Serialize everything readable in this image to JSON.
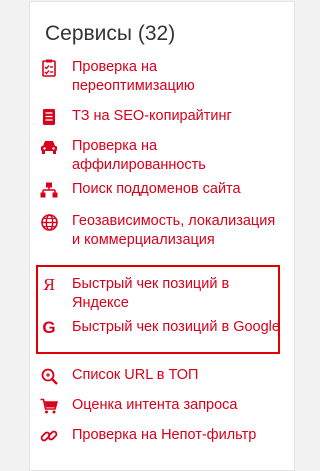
{
  "services": {
    "title": "Сервисы (32)",
    "items": [
      {
        "label": "Проверка на переоптимизацию",
        "icon": "checklist-icon"
      },
      {
        "label": "ТЗ на SEO-копирайтинг",
        "icon": "document-icon"
      },
      {
        "label": "Проверка на аффилированность",
        "icon": "car-icon"
      },
      {
        "label": "Поиск поддоменов сайта",
        "icon": "sitemap-icon"
      },
      {
        "label": "Геозависимость, локализация и коммерциализация",
        "icon": "globe-icon"
      },
      {
        "label": "Быстрый чек позиций в Яндексе",
        "icon": "yandex-icon",
        "glyph": "Я"
      },
      {
        "label": "Быстрый чек позиций в Google",
        "icon": "google-icon",
        "glyph": "G"
      },
      {
        "label": "Список URL в ТОП",
        "icon": "magnifier-icon"
      },
      {
        "label": "Оценка интента запроса",
        "icon": "cart-icon"
      },
      {
        "label": "Проверка на Непот-фильтр",
        "icon": "link-icon"
      }
    ]
  },
  "colors": {
    "accent": "#d9001b",
    "highlight": "#e00000",
    "title": "#333333",
    "background": "#f2f2f2"
  }
}
